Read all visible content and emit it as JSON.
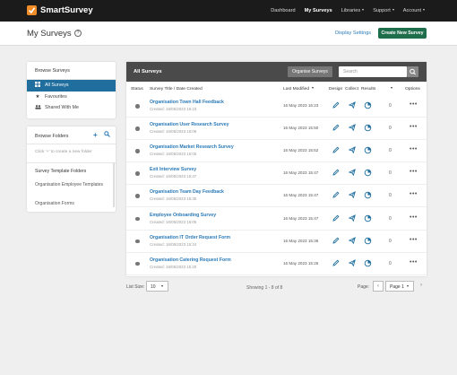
{
  "brand": {
    "name": "SmartSurvey",
    "accent": "#f28c28"
  },
  "nav": {
    "items": [
      {
        "label": "Dashboard",
        "active": false,
        "dropdown": false
      },
      {
        "label": "My Surveys",
        "active": true,
        "dropdown": false
      },
      {
        "label": "Libraries",
        "active": false,
        "dropdown": true
      },
      {
        "label": "Support",
        "active": false,
        "dropdown": true
      },
      {
        "label": "Account",
        "active": false,
        "dropdown": true
      }
    ]
  },
  "header": {
    "title": "My Surveys",
    "help_glyph": "?",
    "display_settings": "Display Settings",
    "create_button": "Create New Survey"
  },
  "sidebar": {
    "browse_surveys": "Browse Surveys",
    "items": [
      {
        "label": "All Surveys",
        "icon": "grid-icon",
        "active": true
      },
      {
        "label": "Favourites",
        "icon": "star-icon",
        "active": false
      },
      {
        "label": "Shared With Me",
        "icon": "people-icon",
        "active": false
      }
    ],
    "browse_folders": "Browse Folders",
    "folder_hint": "Click '+' to create a new folder",
    "template_folders_heading": "Survey Template Folders",
    "template_folders": [
      "Organisation Employee Templates",
      "Organisation Forms"
    ]
  },
  "main": {
    "title": "All Surveys",
    "organise_button": "Organise Surveys",
    "search_placeholder": "Search",
    "columns": {
      "status": "Status",
      "title": "Survey Title / Date Created",
      "modified": "Last Modified",
      "design": "Design",
      "collect": "Collect",
      "results": "Results",
      "options": "Options"
    },
    "rows": [
      {
        "title": "Organisation Town Hall Feedback",
        "created": "Created: 16/05/2023 16:23",
        "modified": "16 May 2023 16:23",
        "results": "0"
      },
      {
        "title": "Organisation User Research Survey",
        "created": "Created: 16/05/2023 16:09",
        "modified": "16 May 2023 15:50",
        "results": "0"
      },
      {
        "title": "Organisation Market Research Survey",
        "created": "Created: 16/05/2023 15:05",
        "modified": "16 May 2023 15:52",
        "results": "0"
      },
      {
        "title": "Exit Interview Survey",
        "created": "Created: 16/05/2023 15:47",
        "modified": "16 May 2023 15:47",
        "results": "0"
      },
      {
        "title": "Organisation Team Day Feedback",
        "created": "Created: 16/05/2023 15:35",
        "modified": "16 May 2023 15:47",
        "results": "0"
      },
      {
        "title": "Employee Onboarding Survey",
        "created": "Created: 16/05/2023 15:05",
        "modified": "16 May 2023 15:47",
        "results": "0"
      },
      {
        "title": "Organisation IT Order Request Form",
        "created": "Created: 16/05/2023 15:24",
        "modified": "16 May 2023 15:36",
        "results": "0"
      },
      {
        "title": "Organisation Catering Request Form",
        "created": "Created: 16/05/2023 15:20",
        "modified": "16 May 2023 15:26",
        "results": "0"
      }
    ]
  },
  "footer": {
    "list_size_label": "List Size:",
    "list_size_value": "10",
    "showing": "Showing 1 - 8 of 8",
    "page_label": "Page:",
    "page_value": "Page 1",
    "prev": "‹",
    "next": "›"
  },
  "colors": {
    "primary_blue": "#1f6e9e",
    "create_green": "#1f6e4b",
    "link_blue": "#2a7ab8"
  }
}
